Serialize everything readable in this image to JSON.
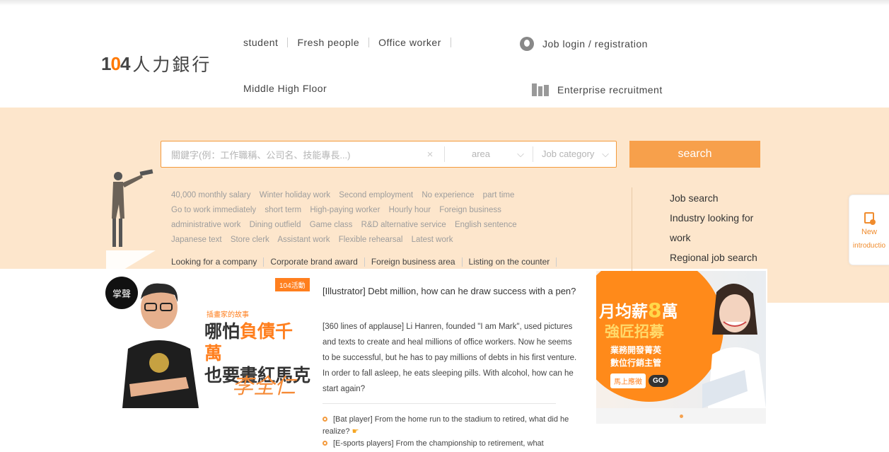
{
  "header": {
    "logo_num": "104",
    "logo_cn": "人力銀行",
    "nav": [
      "student",
      "Fresh people",
      "Office worker"
    ],
    "nav2": "Middle High Floor",
    "login": "Job login / registration",
    "enterprise": "Enterprise recruitment"
  },
  "search": {
    "placeholder": "關鍵字(例：工作職稱、公司名、技能專長...)",
    "clear": "×",
    "area_label": "area",
    "category_label": "Job category",
    "button": "search"
  },
  "tags": [
    "40,000 monthly salary",
    "Winter holiday work",
    "Second employment",
    "No experience",
    "part time",
    "Go to work immediately",
    "short term",
    "High-paying worker",
    "Hourly hour",
    "Foreign business",
    "administrative work",
    "Dining outfield",
    "Game class",
    "R&D alternative service",
    "English sentence",
    "Japanese text",
    "Store clerk",
    "Assistant work",
    "Flexible rehearsal",
    "Latest work"
  ],
  "links": [
    "Looking for a company",
    "Corporate brand award",
    "Foreign business area",
    "Listing on the counter"
  ],
  "side_links": [
    "Job search",
    "Industry looking for work",
    "Regional job search"
  ],
  "new_tab": {
    "label": "New",
    "sub": "introductio"
  },
  "article": {
    "banner_badge": "104活動",
    "banner_seal": "掌聲",
    "banner_sub": "插畫家的故事",
    "banner_line1a": "哪怕",
    "banner_line1b": "負債千萬",
    "banner_line2": "也要畫紅馬克",
    "banner_sig": "李全仁",
    "title": "[Illustrator] Debt million, how can he draw success with a pen?",
    "body": "[360 lines of applause] Li Hanren, founded \"I am Mark\", used pictures and texts to create and heal millions of office workers. Now he seems to be successful, but he has to pay millions of debts in his first venture. In order to fall asleep, he eats sleeping pills. With alcohol, how can he start again?",
    "list": [
      "[Bat player] From the home run to the stadium to retired, what did he realize?",
      "[E-sports players] From the championship to retirement, what"
    ]
  },
  "ad": {
    "t1a": "月均薪",
    "t1b": "8",
    "t1c": "萬",
    "t2": "強匠招募",
    "t3a": "業務開發菁英",
    "t3b": "數位行銷主管",
    "apply": "馬上應徵",
    "go": "GO"
  },
  "colors": {
    "accent": "#f7a04b",
    "band": "#fde6cc"
  }
}
